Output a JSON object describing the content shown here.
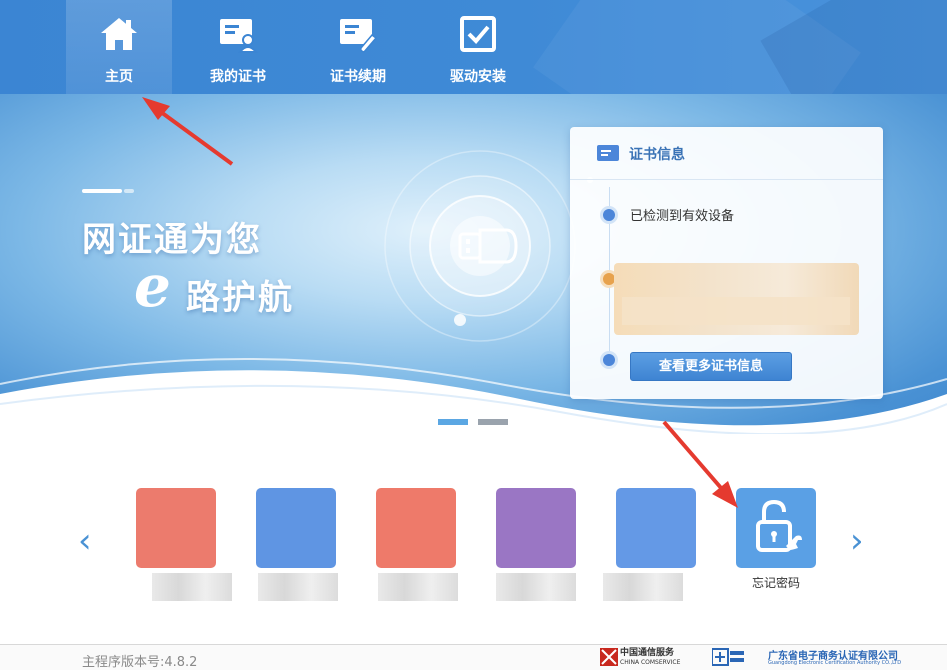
{
  "nav": {
    "items": [
      {
        "label": "主页",
        "icon": "home-icon",
        "active": true
      },
      {
        "label": "我的证书",
        "icon": "certificate-user-icon",
        "active": false
      },
      {
        "label": "证书续期",
        "icon": "certificate-renew-icon",
        "active": false
      },
      {
        "label": "驱动安装",
        "icon": "driver-install-icon",
        "active": false
      }
    ]
  },
  "banner": {
    "slogan_line1": "网证通为您",
    "slogan_line2": "路护航",
    "logo_letter": "e"
  },
  "cert_card": {
    "title": "证书信息",
    "detected_text": "已检测到有效设备",
    "more_button": "查看更多证书信息"
  },
  "apps": {
    "prev": "‹",
    "next": "›",
    "tiles": [
      {
        "color": "#ec7b6d"
      },
      {
        "color": "#5f95e3"
      },
      {
        "color": "#ee7a6a"
      },
      {
        "color": "#9a76c4"
      },
      {
        "color": "#6499e6"
      }
    ],
    "forget_password": {
      "label": "忘记密码",
      "icon": "lock-wrench-icon"
    }
  },
  "footer": {
    "version": "主程序版本号:4.8.2",
    "logo_china_comservice": "中国通信服务",
    "logo_china_comservice_en": "CHINA COMSERVICE",
    "logo_gd_ca": "广东省电子商务认证有限公司",
    "logo_gd_ca_en": "Guangdong Electronic Certification Authority CO.,LTD"
  },
  "colors": {
    "nav_blue": "#3b85d3",
    "accent": "#4c86d9",
    "annotation_red": "#e53a2f"
  }
}
